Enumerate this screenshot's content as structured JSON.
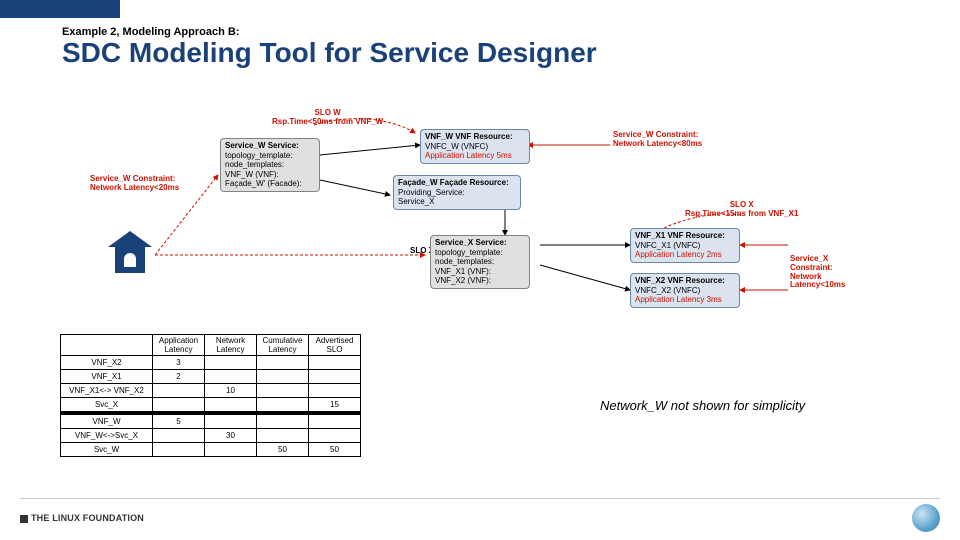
{
  "header": {
    "subtitle": "Example 2, Modeling Approach B:",
    "title": "SDC Modeling Tool for Service Designer"
  },
  "diagram": {
    "slo_w": {
      "title": "SLO W",
      "text": "Rsp.Time<50ms from VNF_W"
    },
    "slo_x": {
      "title": "SLO X",
      "text": "Rsp.Time<15ms from VNF_X1"
    },
    "slo_x_label": "SLO X",
    "constraint_w_left": {
      "l1": "Service_W Constraint:",
      "l2": "Network Latency<20ms"
    },
    "constraint_w_right": {
      "l1": "Service_W Constraint:",
      "l2": "Network Latency<80ms"
    },
    "constraint_x": {
      "l1": "Service_X Constraint:",
      "l2": "Network Latency<10ms"
    },
    "service_w": {
      "t": "Service_W Service:",
      "l1": "topology_template:",
      "l2": "node_templates:",
      "l3": "VNF_W (VNF):",
      "l4": "Façade_W' (Facade):"
    },
    "vnf_w": {
      "t": "VNF_W VNF Resource:",
      "l1": "VNFC_W (VNFC)",
      "red": "Application Latency 5ms"
    },
    "facade_w": {
      "t": "Façade_W Façade Resource:",
      "l1": "Providing_Service:",
      "l2": "Service_X"
    },
    "service_x": {
      "t": "Service_X Service:",
      "l1": "topology_template:",
      "l2": "node_templates:",
      "l3": "VNF_X1 (VNF):",
      "l4": "VNF_X2 (VNF):"
    },
    "vnf_x1": {
      "t": "VNF_X1 VNF Resource:",
      "l1": "VNFC_X1 (VNFC)",
      "red": "Application Latency 2ms"
    },
    "vnf_x2": {
      "t": "VNF_X2 VNF Resource:",
      "l1": "VNFC_X2 (VNFC)",
      "red": "Application Latency 3ms"
    }
  },
  "table": {
    "headers": [
      "",
      "Application Latency",
      "Network Latency",
      "Cumulative Latency",
      "Advertised SLO"
    ],
    "rows": [
      {
        "label": "VNF_X2",
        "app": "3",
        "net": "",
        "cum": "",
        "slo": ""
      },
      {
        "label": "VNF_X1",
        "app": "2",
        "net": "",
        "cum": "",
        "slo": ""
      },
      {
        "label": "VNF_X1<-> VNF_X2",
        "app": "",
        "net": "10",
        "cum": "",
        "slo": ""
      },
      {
        "label": "Svc_X",
        "app": "",
        "net": "",
        "cum": "",
        "slo": "15"
      }
    ],
    "rows2": [
      {
        "label": "VNF_W",
        "app": "5",
        "net": "",
        "cum": "",
        "slo": ""
      },
      {
        "label": "VNF_W<->Svc_X",
        "app": "",
        "net": "30",
        "cum": "",
        "slo": ""
      },
      {
        "label": "Svc_W",
        "app": "",
        "net": "",
        "cum": "50",
        "slo": "50"
      }
    ]
  },
  "note": "Network_W not shown for simplicity",
  "footer": {
    "linux": "THE LINUX FOUNDATION"
  }
}
